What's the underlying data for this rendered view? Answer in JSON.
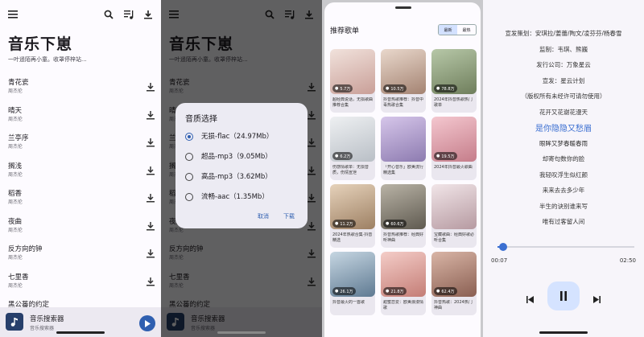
{
  "app": {
    "title": "音乐下崽",
    "subtitle": "一叶遥陌再小童。收罩停梓站..."
  },
  "songs": [
    {
      "title": "青花瓷",
      "artist": "周杰伦"
    },
    {
      "title": "晴天",
      "artist": "周杰伦"
    },
    {
      "title": "兰亭序",
      "artist": "周杰伦"
    },
    {
      "title": "搁浅",
      "artist": "周杰伦"
    },
    {
      "title": "稻香",
      "artist": "周杰伦"
    },
    {
      "title": "夜曲",
      "artist": "周杰伦"
    },
    {
      "title": "反方向的钟",
      "artist": "周杰伦"
    },
    {
      "title": "七里香",
      "artist": "周杰伦"
    },
    {
      "title": "黑公蕃的约定",
      "artist": ""
    }
  ],
  "player": {
    "title": "音乐搜索器",
    "subtitle": "音乐搜索器"
  },
  "dialog": {
    "title": "音质选择",
    "options": [
      {
        "label": "无损-flac（24.97Mb）",
        "selected": true
      },
      {
        "label": "超品-mp3（9.05Mb）",
        "selected": false
      },
      {
        "label": "高品-mp3（3.62Mb）",
        "selected": false
      },
      {
        "label": "流畅-aac（1.35Mb）",
        "selected": false
      }
    ],
    "cancel": "取消",
    "download": "下载"
  },
  "playlists": {
    "title": "推荐歌单",
    "segments": [
      "最新",
      "最热"
    ],
    "cards": [
      {
        "count": "5.7万",
        "title": "超经典说话，无损歌曲推荐合集",
        "color": "#d8b7b3"
      },
      {
        "count": "10.5万",
        "title": "抖音热歌推荐：抖音中毒热歌合集",
        "color": "#c7a28f"
      },
      {
        "count": "78.8万",
        "title": "2024年抖音热歌热门歌单",
        "color": "#9fb38f"
      },
      {
        "count": "6.2万",
        "title": "伤感情歌单：无损音质，伤情宣泄",
        "color": "#d9dde2"
      },
      {
        "count": "",
        "title": "「开心音乐」欧美流行精选集",
        "color": "#b8a8d1"
      },
      {
        "count": "19.5万",
        "title": "2024年抖音最火歌曲",
        "color": "#e0a1ad"
      },
      {
        "count": "11.2万",
        "title": "2024年热歌合集·抖音精选",
        "color": "#c4a98b"
      },
      {
        "count": "60.6万",
        "title": "抖音热歌推荐：经典好听神曲",
        "color": "#8f8a7c"
      },
      {
        "count": "",
        "title": "宝藏歌曲：经典好歌必听合集",
        "color": "#d9c3c8"
      },
      {
        "count": "26.1万",
        "title": "抖音最火的一首歌",
        "color": "#7f9bb3"
      },
      {
        "count": "21.8万",
        "title": "甜蜜恋爱：欧美浪漫情歌",
        "color": "#e2a8a2"
      },
      {
        "count": "62.4万",
        "title": "抖音热歌：2024热门神曲",
        "color": "#b58c7d"
      }
    ]
  },
  "lyrics": {
    "lines": [
      "宣发策划：安琪拉/姜蕾/陶文/凌芬芬/杨春雪",
      "监制：韦琪、熊巍",
      "发行公司：万象星云",
      "宣发：星云计划",
      "（版权所有未经许可请勿使用）",
      "花开又花谢花漫天",
      "是你隐隐又愁眉",
      "眼眸又梦春暖春雨",
      "却寄句数你的脸",
      "我轻叹浮生似红颜",
      "来来去去多少年",
      "半生的诀别谁来写",
      "唯有过客留人间"
    ],
    "current_index": 6,
    "time_current": "00:07",
    "time_total": "02:50",
    "progress": 0.04
  }
}
